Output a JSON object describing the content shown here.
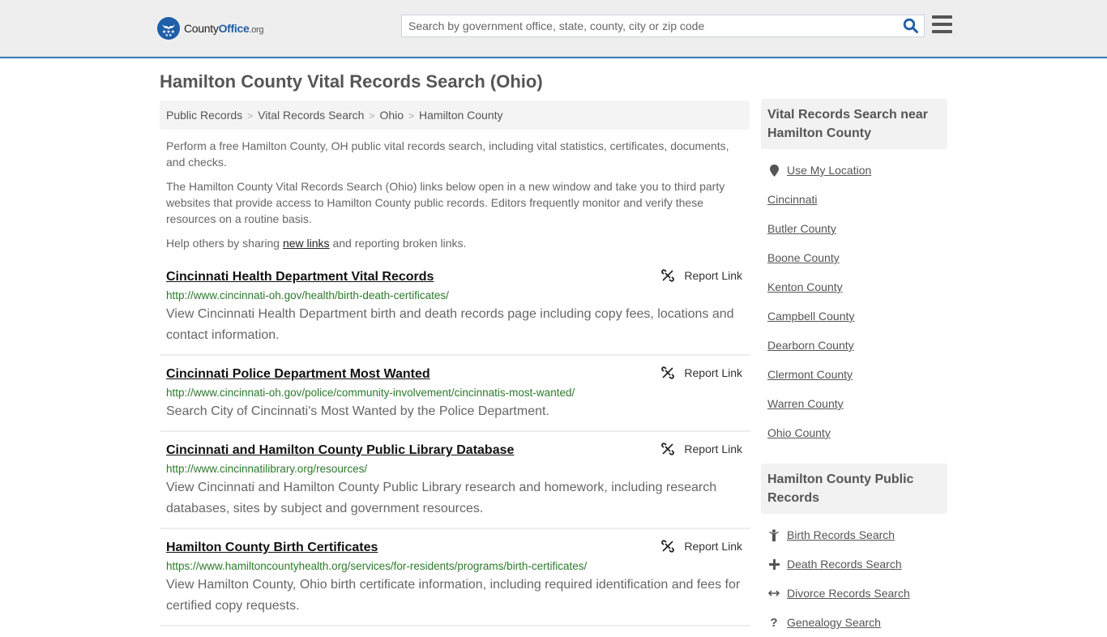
{
  "header": {
    "logo": {
      "brand_a": "County",
      "brand_b": "Office",
      "brand_c": ".org"
    },
    "search_placeholder": "Search by government office, state, county, city or zip code",
    "colors": {
      "brand": "#1f5ea8",
      "accent_border": "#3a7bb0"
    }
  },
  "page": {
    "title": "Hamilton County Vital Records Search (Ohio)",
    "breadcrumb": [
      "Public Records",
      "Vital Records Search",
      "Ohio",
      "Hamilton County"
    ],
    "intro": [
      "Perform a free Hamilton County, OH public vital records search, including vital statistics, certificates, documents, and checks.",
      "The Hamilton County Vital Records Search (Ohio) links below open in a new window and take you to third party websites that provide access to Hamilton County public records. Editors frequently monitor and verify these resources on a routine basis."
    ],
    "help": {
      "before": "Help others by sharing ",
      "link": "new links",
      "after": " and reporting broken links."
    }
  },
  "results": [
    {
      "title": "Cincinnati Health Department Vital Records",
      "url": "http://www.cincinnati-oh.gov/health/birth-death-certificates/",
      "description": "View Cincinnati Health Department birth and death records page including copy fees, locations and contact information.",
      "report_label": "Report Link"
    },
    {
      "title": "Cincinnati Police Department Most Wanted",
      "url": "http://www.cincinnati-oh.gov/police/community-involvement/cincinnatis-most-wanted/",
      "description": "Search City of Cincinnati's Most Wanted by the Police Department.",
      "report_label": "Report Link"
    },
    {
      "title": "Cincinnati and Hamilton County Public Library Database",
      "url": "http://www.cincinnatilibrary.org/resources/",
      "description": "View Cincinnati and Hamilton County Public Library research and homework, including research databases, sites by subject and government resources.",
      "report_label": "Report Link"
    },
    {
      "title": "Hamilton County Birth Certificates",
      "url": "https://www.hamiltoncountyhealth.org/services/for-residents/programs/birth-certificates/",
      "description": "View Hamilton County, Ohio birth certificate information, including required identification and fees for certified copy requests.",
      "report_label": "Report Link"
    }
  ],
  "sidebar": {
    "nearby": {
      "heading": "Vital Records Search near Hamilton County",
      "use_location": "Use My Location",
      "items": [
        "Cincinnati",
        "Butler County",
        "Boone County",
        "Kenton County",
        "Campbell County",
        "Dearborn County",
        "Clermont County",
        "Warren County",
        "Ohio County"
      ]
    },
    "public_records": {
      "heading": "Hamilton County Public Records",
      "items": [
        {
          "label": "Birth Records Search",
          "icon": "child-icon"
        },
        {
          "label": "Death Records Search",
          "icon": "plus-icon"
        },
        {
          "label": "Divorce Records Search",
          "icon": "arrows-horizontal-icon"
        },
        {
          "label": "Genealogy Search",
          "icon": "question-icon"
        }
      ]
    }
  }
}
